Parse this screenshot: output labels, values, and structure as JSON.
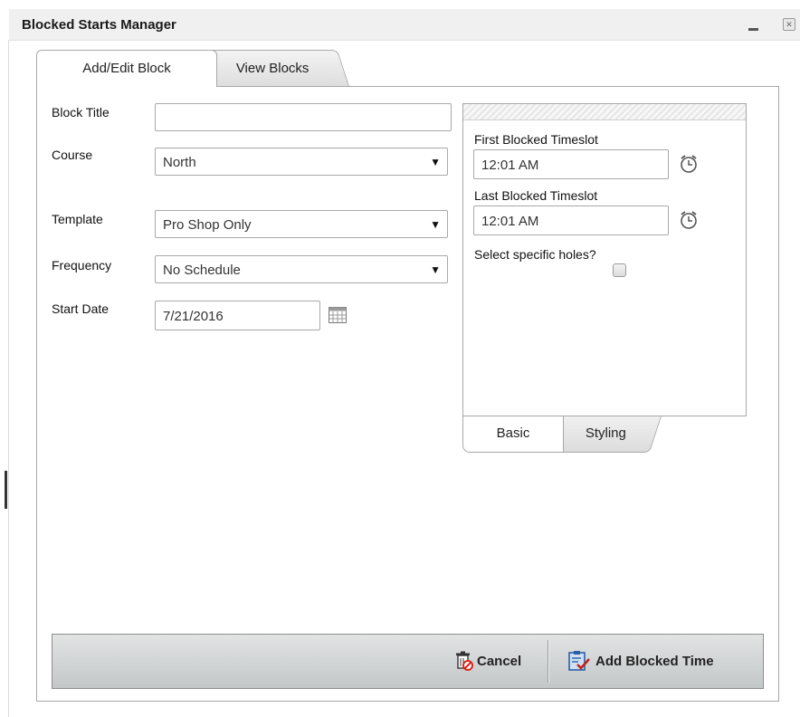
{
  "window": {
    "title": "Blocked Starts Manager"
  },
  "tabs": [
    {
      "label": "Add/Edit Block",
      "active": true
    },
    {
      "label": "View Blocks",
      "active": false
    }
  ],
  "form": {
    "block_title": {
      "label": "Block Title",
      "value": ""
    },
    "course": {
      "label": "Course",
      "value": "North"
    },
    "template": {
      "label": "Template",
      "value": "Pro Shop Only"
    },
    "frequency": {
      "label": "Frequency",
      "value": "No Schedule"
    },
    "start_date": {
      "label": "Start Date",
      "value": "7/21/2016"
    }
  },
  "timeslots": {
    "first": {
      "label": "First Blocked Timeslot",
      "value": "12:01 AM"
    },
    "last": {
      "label": "Last Blocked Timeslot",
      "value": "12:01 AM"
    },
    "holes": {
      "label": "Select specific holes?",
      "checked": false
    }
  },
  "subtabs": [
    {
      "label": "Basic",
      "active": true
    },
    {
      "label": "Styling",
      "active": false
    }
  ],
  "footer": {
    "cancel_label": "Cancel",
    "add_label": "Add Blocked Time"
  },
  "colors": {
    "footer_bg": "#c8cccc",
    "cancel_icon_red": "#d9261c",
    "add_icon_blue": "#2b5fa8"
  }
}
